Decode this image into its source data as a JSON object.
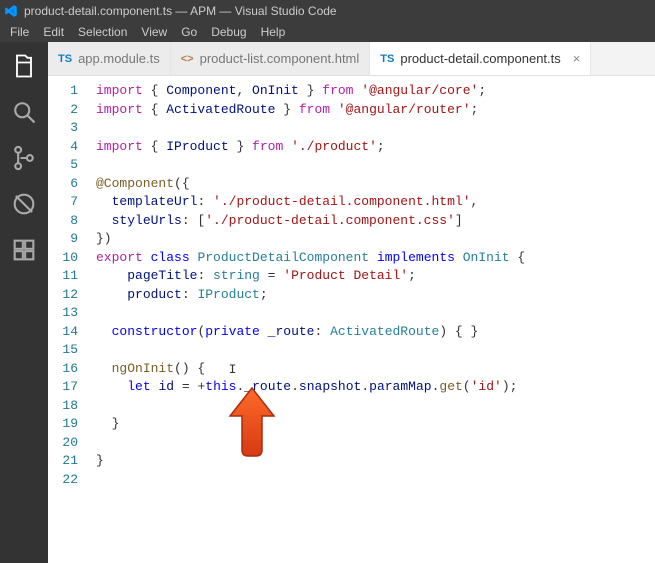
{
  "window": {
    "title": "product-detail.component.ts — APM — Visual Studio Code"
  },
  "menu": {
    "file": "File",
    "edit": "Edit",
    "selection": "Selection",
    "view": "View",
    "go": "Go",
    "debug": "Debug",
    "help": "Help"
  },
  "tabs": {
    "t0": {
      "icon": "TS",
      "label": "app.module.ts"
    },
    "t1": {
      "icon": "<>",
      "label": "product-list.component.html"
    },
    "t2": {
      "icon": "TS",
      "label": "product-detail.component.ts",
      "close": "×"
    }
  },
  "lineno": {
    "l1": "1",
    "l2": "2",
    "l3": "3",
    "l4": "4",
    "l5": "5",
    "l6": "6",
    "l7": "7",
    "l8": "8",
    "l9": "9",
    "l10": "10",
    "l11": "11",
    "l12": "12",
    "l13": "13",
    "l14": "14",
    "l15": "15",
    "l16": "16",
    "l17": "17",
    "l18": "18",
    "l19": "19",
    "l20": "20",
    "l21": "21",
    "l22": "22"
  },
  "code": {
    "import_kw": "import",
    "from_kw": "from",
    "export_kw": "export",
    "class_kw": "class",
    "implements_kw": "implements",
    "let_kw": "let",
    "private_kw": "private",
    "this_kw": "this",
    "string_t": "string",
    "Component": "Component",
    "OnInit": "OnInit",
    "ActivatedRoute": "ActivatedRoute",
    "IProduct": "IProduct",
    "ProductDetailComponent": "ProductDetailComponent",
    "atComponent": "@Component",
    "templateUrl": "templateUrl",
    "styleUrls": "styleUrls",
    "pageTitle": "pageTitle",
    "product": "product",
    "constructor": "constructor",
    "_route": "_route",
    "ngOnInit": "ngOnInit",
    "id": "id",
    "snapshot": "snapshot",
    "paramMap": "paramMap",
    "get": "get",
    "str_core": "'@angular/core'",
    "str_router": "'@angular/router'",
    "str_product": "'./product'",
    "str_html": "'./product-detail.component.html'",
    "str_css": "'./product-detail.component.css'",
    "str_pd": "'Product Detail'",
    "str_id": "'id'"
  }
}
